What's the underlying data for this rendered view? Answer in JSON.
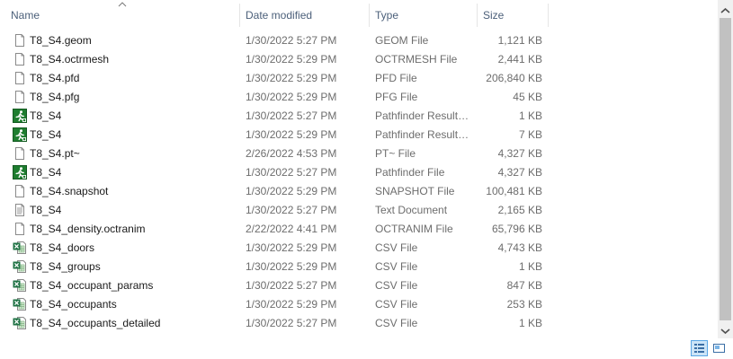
{
  "columns": {
    "name": "Name",
    "date_modified": "Date modified",
    "type": "Type",
    "size": "Size"
  },
  "sort": {
    "column": "name",
    "direction": "ascending",
    "icon": "sort-up-arrow-icon"
  },
  "files": [
    {
      "name": "T8_S4.geom",
      "date": "1/30/2022 5:27 PM",
      "type": "GEOM File",
      "size": "1,121 KB",
      "icon": "blank-file-icon"
    },
    {
      "name": "T8_S4.octrmesh",
      "date": "1/30/2022 5:29 PM",
      "type": "OCTRMESH File",
      "size": "2,441 KB",
      "icon": "blank-file-icon"
    },
    {
      "name": "T8_S4.pfd",
      "date": "1/30/2022 5:29 PM",
      "type": "PFD File",
      "size": "206,840 KB",
      "icon": "blank-file-icon"
    },
    {
      "name": "T8_S4.pfg",
      "date": "1/30/2022 5:29 PM",
      "type": "PFG File",
      "size": "45 KB",
      "icon": "blank-file-icon"
    },
    {
      "name": "T8_S4",
      "date": "1/30/2022 5:27 PM",
      "type": "Pathfinder Results...",
      "size": "1 KB",
      "icon": "pathfinder-runner-icon"
    },
    {
      "name": "T8_S4",
      "date": "1/30/2022 5:29 PM",
      "type": "Pathfinder Results...",
      "size": "7 KB",
      "icon": "pathfinder-runner-icon"
    },
    {
      "name": "T8_S4.pt~",
      "date": "2/26/2022 4:53 PM",
      "type": "PT~ File",
      "size": "4,327 KB",
      "icon": "blank-file-icon"
    },
    {
      "name": "T8_S4",
      "date": "1/30/2022 5:27 PM",
      "type": "Pathfinder File",
      "size": "4,327 KB",
      "icon": "pathfinder-runner-icon"
    },
    {
      "name": "T8_S4.snapshot",
      "date": "1/30/2022 5:29 PM",
      "type": "SNAPSHOT File",
      "size": "100,481 KB",
      "icon": "blank-file-icon"
    },
    {
      "name": "T8_S4",
      "date": "1/30/2022 5:27 PM",
      "type": "Text Document",
      "size": "2,165 KB",
      "icon": "text-document-icon"
    },
    {
      "name": "T8_S4_density.octranim",
      "date": "2/22/2022 4:41 PM",
      "type": "OCTRANIM File",
      "size": "65,796 KB",
      "icon": "blank-file-icon"
    },
    {
      "name": "T8_S4_doors",
      "date": "1/30/2022 5:29 PM",
      "type": "CSV File",
      "size": "4,743 KB",
      "icon": "csv-file-icon"
    },
    {
      "name": "T8_S4_groups",
      "date": "1/30/2022 5:29 PM",
      "type": "CSV File",
      "size": "1 KB",
      "icon": "csv-file-icon"
    },
    {
      "name": "T8_S4_occupant_params",
      "date": "1/30/2022 5:27 PM",
      "type": "CSV File",
      "size": "847 KB",
      "icon": "csv-file-icon"
    },
    {
      "name": "T8_S4_occupants",
      "date": "1/30/2022 5:29 PM",
      "type": "CSV File",
      "size": "253 KB",
      "icon": "csv-file-icon"
    },
    {
      "name": "T8_S4_occupants_detailed",
      "date": "1/30/2022 5:27 PM",
      "type": "CSV File",
      "size": "1 KB",
      "icon": "csv-file-icon"
    }
  ],
  "scrollbar": {
    "up_icon": "scroll-up-arrow-icon",
    "down_icon": "scroll-down-arrow-icon"
  },
  "view_buttons": [
    {
      "id": "details",
      "icon": "details-view-icon",
      "active": true
    },
    {
      "id": "large-icons",
      "icon": "large-icons-view-icon",
      "active": false
    }
  ],
  "colors": {
    "header_text": "#4c607a",
    "secondary_text": "#6d6d6d",
    "pathfinder_green": "#1e7d2f",
    "csv_green": "#217346",
    "active_view_bg": "#cce4f7"
  }
}
